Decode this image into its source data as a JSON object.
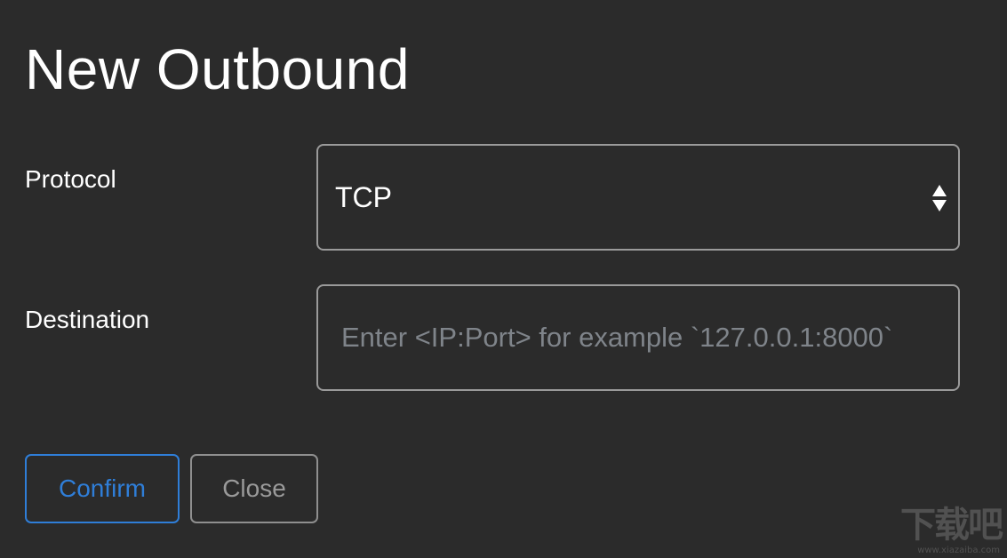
{
  "dialog": {
    "title": "New Outbound"
  },
  "form": {
    "protocol": {
      "label": "Protocol",
      "selected_value": "TCP"
    },
    "destination": {
      "label": "Destination",
      "value": "",
      "placeholder": "Enter <IP:Port> for example `127.0.0.1:8000`"
    }
  },
  "actions": {
    "confirm_label": "Confirm",
    "close_label": "Close"
  },
  "watermark": {
    "logo_text": "下载吧",
    "url": "www.xiazaiba.com"
  },
  "colors": {
    "background": "#2b2b2b",
    "accent": "#2f7ed8",
    "field_border": "#9a9a9a",
    "placeholder": "#7f848a"
  },
  "icons": {
    "select_arrows": "up-down-chevron-icon"
  }
}
